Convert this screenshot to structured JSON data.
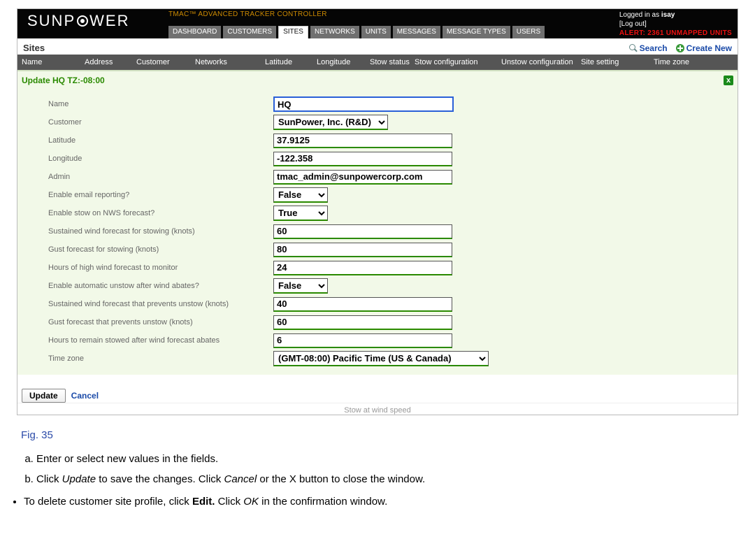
{
  "header": {
    "app_title": "TMAC™ ADVANCED TRACKER CONTROLLER",
    "logo_left": "SUNP",
    "logo_right": "WER",
    "logged_in_prefix": "Logged in as ",
    "logged_in_user": "isay",
    "logout": "[Log out]",
    "alert": "ALERT: 2361 UNMAPPED UNITS",
    "tabs": [
      "DASHBOARD",
      "CUSTOMERS",
      "SITES",
      "NETWORKS",
      "UNITS",
      "MESSAGES",
      "MESSAGE TYPES",
      "USERS"
    ],
    "active_tab_index": 2
  },
  "sites": {
    "title": "Sites",
    "search_label": "Search",
    "create_label": "Create New",
    "columns": [
      "Name",
      "Address",
      "Customer",
      "Networks",
      "Latitude",
      "Longitude",
      "Stow status",
      "Stow configuration",
      "Unstow configuration",
      "Site setting",
      "Time zone"
    ]
  },
  "form": {
    "title": "Update HQ TZ:-08:00",
    "close": "x",
    "fields": {
      "name": {
        "label": "Name",
        "value": "HQ"
      },
      "customer": {
        "label": "Customer",
        "value": "SunPower, Inc. (R&D)"
      },
      "latitude": {
        "label": "Latitude",
        "value": "37.9125"
      },
      "longitude": {
        "label": "Longitude",
        "value": "-122.358"
      },
      "admin": {
        "label": "Admin",
        "value": "tmac_admin@sunpowercorp.com"
      },
      "email_report": {
        "label": "Enable email reporting?",
        "value": "False"
      },
      "stow_nws": {
        "label": "Enable stow on NWS forecast?",
        "value": "True"
      },
      "sust_stow": {
        "label": "Sustained wind forecast for stowing (knots)",
        "value": "60"
      },
      "gust_stow": {
        "label": "Gust forecast for stowing (knots)",
        "value": "80"
      },
      "hours_monitor": {
        "label": "Hours of high wind forecast to monitor",
        "value": "24"
      },
      "auto_unstow": {
        "label": "Enable automatic unstow after wind abates?",
        "value": "False"
      },
      "sust_unstow": {
        "label": "Sustained wind forecast that prevents unstow (knots)",
        "value": "40"
      },
      "gust_unstow": {
        "label": "Gust forecast that prevents unstow (knots)",
        "value": "60"
      },
      "hours_abate": {
        "label": "Hours to remain stowed after wind forecast abates",
        "value": "6"
      },
      "timezone": {
        "label": "Time zone",
        "value": "(GMT-08:00) Pacific Time (US & Canada)"
      }
    },
    "update_btn": "Update",
    "cancel_btn": "Cancel",
    "footer_hint": "Stow at wind speed"
  },
  "doc": {
    "fig": "Fig. 35",
    "a": "Enter or select new values in the fields.",
    "b_1": "Click ",
    "b_2": "Update",
    "b_3": " to save the changes. Click ",
    "b_4": "Cancel",
    "b_5": " or the X button to close the window.",
    "bullet_1": "To delete customer site profile, click ",
    "bullet_2": "Edit.",
    "bullet_3": " Click ",
    "bullet_4": "OK",
    "bullet_5": " in the confirmation window."
  }
}
